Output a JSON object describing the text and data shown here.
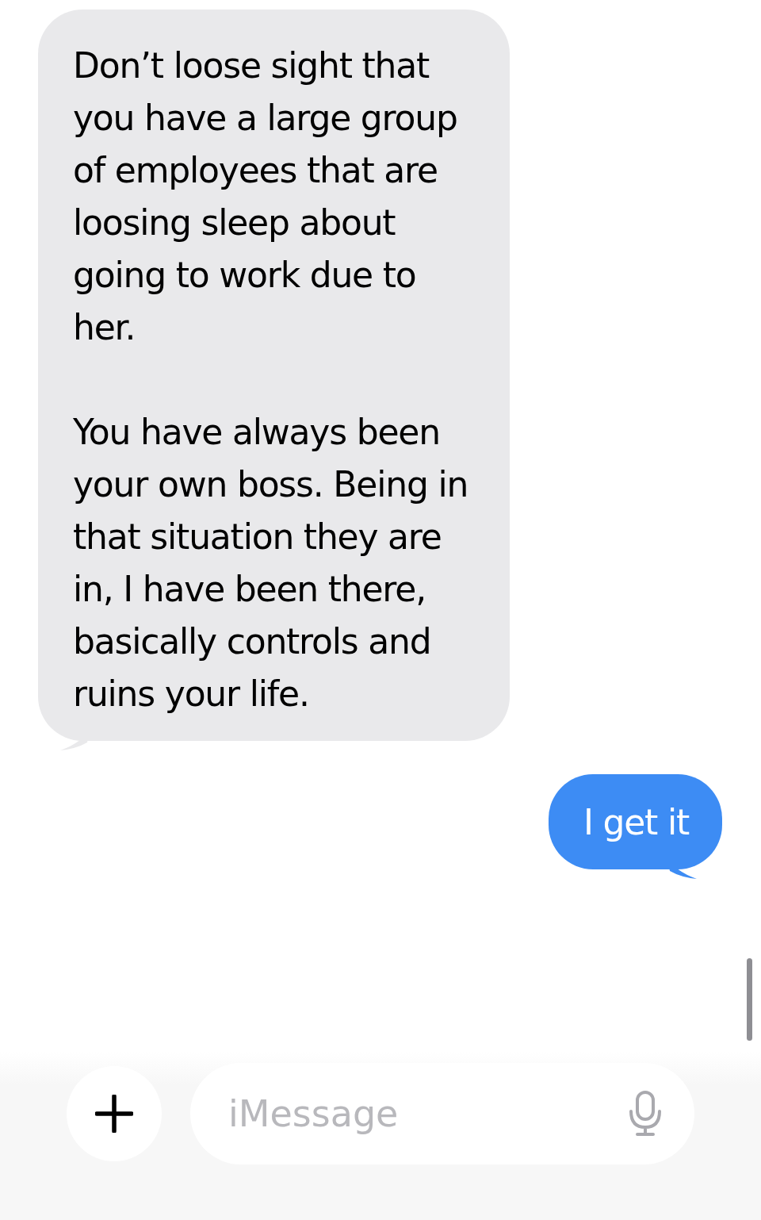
{
  "messages": [
    {
      "kind": "received",
      "paragraphs": [
        "Don’t loose sight that you have a large group of employees that are loosing sleep about going to work due to her.",
        "You have always been your own boss. Being in that situation they are in, I have been there, basically controls and ruins your life."
      ]
    },
    {
      "kind": "sent",
      "paragraphs": [
        "I get it"
      ]
    }
  ],
  "composer": {
    "placeholder": "iMessage"
  }
}
